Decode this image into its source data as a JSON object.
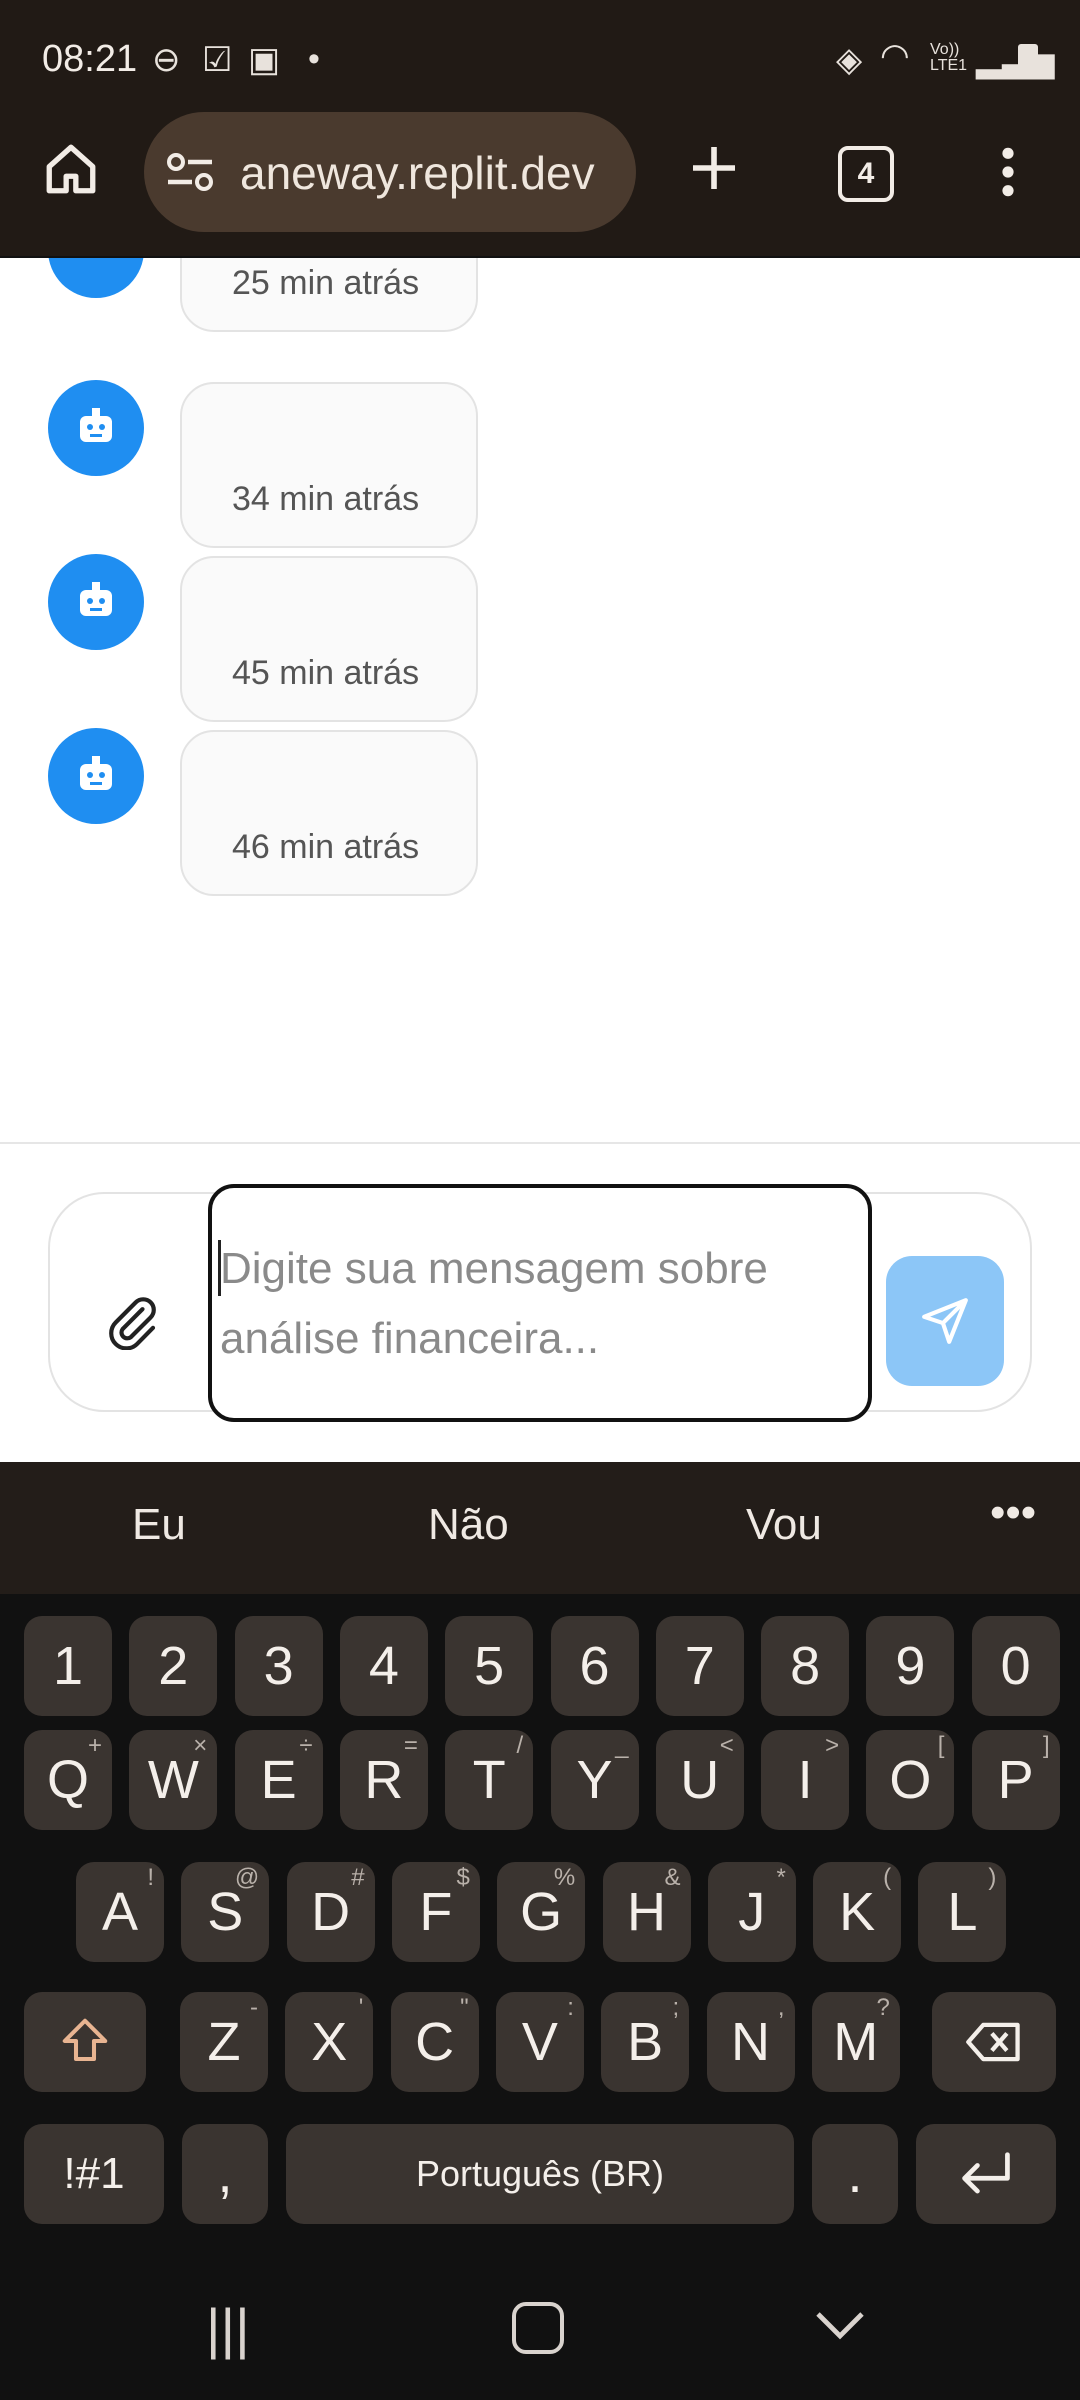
{
  "status_bar": {
    "time": "08:21"
  },
  "browser": {
    "url": "aneway.replit.dev",
    "tab_count": "4"
  },
  "chat": {
    "messages": [
      {
        "time": "25 min atrás"
      },
      {
        "time": "34 min atrás"
      },
      {
        "time": "45 min atrás"
      },
      {
        "time": "46 min atrás"
      }
    ]
  },
  "composer": {
    "placeholder": "Digite sua mensagem sobre análise financeira..."
  },
  "keyboard": {
    "suggestions": [
      "Eu",
      "Não",
      "Vou"
    ],
    "numbers": [
      "1",
      "2",
      "3",
      "4",
      "5",
      "6",
      "7",
      "8",
      "9",
      "0"
    ],
    "row1": [
      "Q",
      "W",
      "E",
      "R",
      "T",
      "Y",
      "U",
      "I",
      "O",
      "P"
    ],
    "row1_hints": [
      "+",
      "×",
      "÷",
      "=",
      "/",
      "_",
      "<",
      ">",
      "[",
      "]"
    ],
    "row2": [
      "A",
      "S",
      "D",
      "F",
      "G",
      "H",
      "J",
      "K",
      "L"
    ],
    "row2_hints": [
      "!",
      "@",
      "#",
      "$",
      "%",
      "&",
      "*",
      "(",
      ")"
    ],
    "row3": [
      "Z",
      "X",
      "C",
      "V",
      "B",
      "N",
      "M"
    ],
    "row3_hints": [
      "-",
      "'",
      "\"",
      ":",
      ";",
      ",",
      "?"
    ],
    "symbols_label": "!#1",
    "comma_label": ",",
    "space_label": "Português (BR)",
    "period_label": "."
  },
  "colors": {
    "accent": "#1f8ef1",
    "send_button": "#8cc6f7",
    "chrome": "#211a15"
  }
}
